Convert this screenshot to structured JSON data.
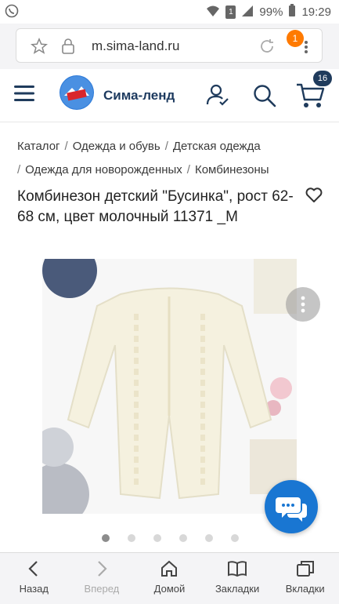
{
  "status_bar": {
    "battery": "99%",
    "time": "19:29",
    "sim_label": "1"
  },
  "browser": {
    "url": "m.sima-land.ru",
    "notification_count": "1"
  },
  "site_header": {
    "brand": "Сима-ленд",
    "logo_text": "СИМА ЛЕНД",
    "cart_count": "16"
  },
  "breadcrumbs": [
    "Каталог",
    "Одежда и обувь",
    "Детская одежда",
    "Одежда для новорожденных",
    "Комбинезоны"
  ],
  "product": {
    "title": "Комбинезон детский \"Бусинка\", рост 62-68 см, цвет молочный 11371 _М"
  },
  "gallery": {
    "dots": 6,
    "active_index": 0
  },
  "bottom_nav": [
    {
      "label": "Назад",
      "icon": "back-icon",
      "disabled": false
    },
    {
      "label": "Вперед",
      "icon": "forward-icon",
      "disabled": true
    },
    {
      "label": "Домой",
      "icon": "home-icon",
      "disabled": false
    },
    {
      "label": "Закладки",
      "icon": "bookmarks-icon",
      "disabled": false
    },
    {
      "label": "Вкладки",
      "icon": "tabs-icon",
      "disabled": false
    }
  ],
  "colors": {
    "accent_blue": "#1976d2",
    "brand_navy": "#1f3b5c",
    "badge_orange": "#ff7a00"
  }
}
